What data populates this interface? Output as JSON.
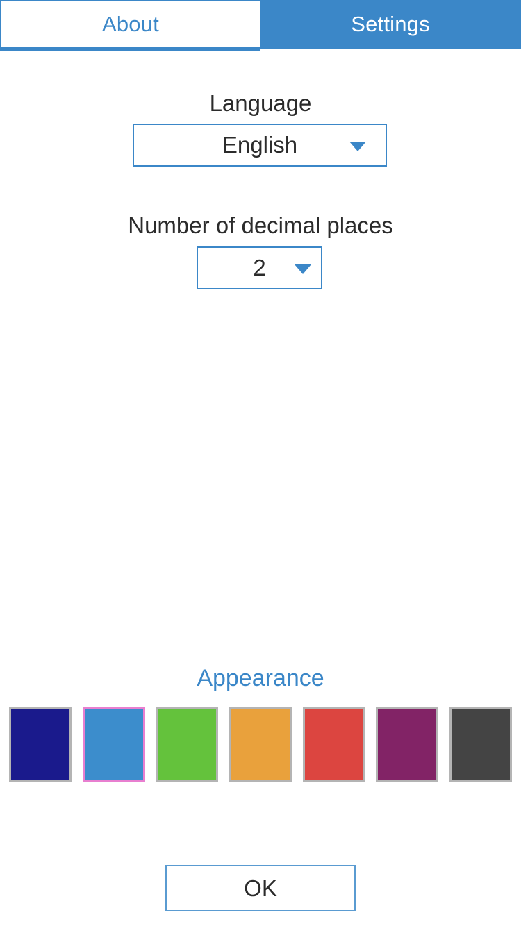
{
  "tabs": [
    {
      "label": "About",
      "active": false
    },
    {
      "label": "Settings",
      "active": true
    }
  ],
  "settings": {
    "language": {
      "label": "Language",
      "value": "English",
      "caret": "chevron-down-icon"
    },
    "decimals": {
      "label": "Number of decimal places",
      "value": "2",
      "caret": "chevron-down-icon"
    }
  },
  "appearance": {
    "title": "Appearance",
    "selected_index": 1,
    "swatches": [
      {
        "name": "navy",
        "color": "#1a1a8c"
      },
      {
        "name": "blue",
        "color": "#3c8dcc"
      },
      {
        "name": "green",
        "color": "#64c23c"
      },
      {
        "name": "orange",
        "color": "#e9a13c"
      },
      {
        "name": "red",
        "color": "#dc4540"
      },
      {
        "name": "purple",
        "color": "#822366"
      },
      {
        "name": "dark-gray",
        "color": "#444444"
      }
    ],
    "selection_border_color": "#e87fd0",
    "swatch_border_color": "#b4b4b4"
  },
  "footer": {
    "ok_label": "OK"
  },
  "theme": {
    "accent": "#3b87c8",
    "text": "#2b2b2b",
    "background": "#ffffff"
  }
}
